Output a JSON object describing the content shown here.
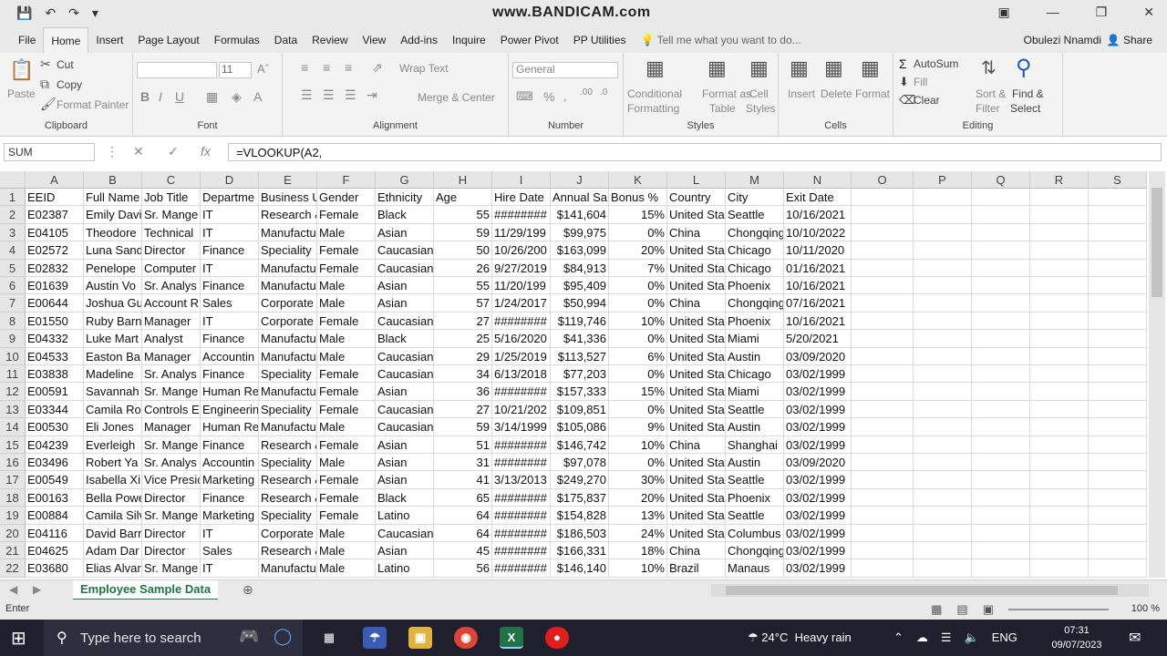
{
  "window": {
    "title": "www.BANDICAM.com",
    "user": "Obulezi Nnamdi",
    "share": "Share"
  },
  "tabs": [
    "File",
    "Home",
    "Insert",
    "Page Layout",
    "Formulas",
    "Data",
    "Review",
    "View",
    "Add-ins",
    "Inquire",
    "Power Pivot",
    "PP Utilities"
  ],
  "tell_me": "Tell me what you want to do...",
  "ribbon": {
    "clipboard": {
      "paste": "Paste",
      "cut": "Cut",
      "copy": "Copy",
      "format_painter": "Format Painter",
      "label": "Clipboard"
    },
    "font": {
      "size": "11",
      "label": "Font"
    },
    "alignment": {
      "wrap": "Wrap Text",
      "merge": "Merge & Center",
      "label": "Alignment"
    },
    "number": {
      "format": "General",
      "label": "Number"
    },
    "styles": {
      "conditional": "Conditional",
      "conditional2": "Formatting",
      "format_as": "Format as",
      "format_as2": "Table",
      "cell": "Cell",
      "cell2": "Styles",
      "label": "Styles"
    },
    "cells": {
      "insert": "Insert",
      "delete": "Delete",
      "format": "Format",
      "label": "Cells"
    },
    "editing": {
      "autosum": "AutoSum",
      "fill": "Fill",
      "clear": "Clear",
      "sort": "Sort &",
      "sort2": "Filter",
      "find": "Find &",
      "find2": "Select",
      "label": "Editing"
    }
  },
  "formula_bar": {
    "name_box": "SUM",
    "formula": "=VLOOKUP(A2,"
  },
  "columns": [
    "A",
    "B",
    "C",
    "D",
    "E",
    "F",
    "G",
    "H",
    "I",
    "J",
    "K",
    "L",
    "M",
    "N",
    "O",
    "P",
    "Q",
    "R",
    "S"
  ],
  "rows": [
    [
      "EEID",
      "Full Name",
      "Job Title",
      "Departme",
      "Business U",
      "Gender",
      "Ethnicity",
      "Age",
      "Hire Date",
      "Annual Sa",
      "Bonus %",
      "Country",
      "City",
      "Exit Date"
    ],
    [
      "E02387",
      "Emily Davi",
      "Sr. Mange",
      "IT",
      "Research &",
      "Female",
      "Black",
      "55",
      "########",
      "$141,604",
      "15%",
      "United Sta",
      "Seattle",
      "10/16/2021"
    ],
    [
      "E04105",
      "Theodore",
      "Technical",
      "IT",
      "Manufactu",
      "Male",
      "Asian",
      "59",
      "11/29/199",
      "$99,975",
      "0%",
      "China",
      "Chongqing",
      "10/10/2022"
    ],
    [
      "E02572",
      "Luna Sand",
      "Director",
      "Finance",
      "Speciality",
      "Female",
      "Caucasian",
      "50",
      "10/26/200",
      "$163,099",
      "20%",
      "United Sta",
      "Chicago",
      "10/11/2020"
    ],
    [
      "E02832",
      "Penelope",
      "Computer",
      "IT",
      "Manufactu",
      "Female",
      "Caucasian",
      "26",
      "9/27/2019",
      "$84,913",
      "7%",
      "United Sta",
      "Chicago",
      "01/16/2021"
    ],
    [
      "E01639",
      "Austin Vo",
      "Sr. Analys",
      "Finance",
      "Manufactu",
      "Male",
      "Asian",
      "55",
      "11/20/199",
      "$95,409",
      "0%",
      "United Sta",
      "Phoenix",
      "10/16/2021"
    ],
    [
      "E00644",
      "Joshua Gu",
      "Account R",
      "Sales",
      "Corporate",
      "Male",
      "Asian",
      "57",
      "1/24/2017",
      "$50,994",
      "0%",
      "China",
      "Chongqing",
      "07/16/2021"
    ],
    [
      "E01550",
      "Ruby Barn",
      "Manager",
      "IT",
      "Corporate",
      "Female",
      "Caucasian",
      "27",
      "########",
      "$119,746",
      "10%",
      "United Sta",
      "Phoenix",
      "10/16/2021"
    ],
    [
      "E04332",
      "Luke Mart",
      "Analyst",
      "Finance",
      "Manufactu",
      "Male",
      "Black",
      "25",
      "5/16/2020",
      "$41,336",
      "0%",
      "United Sta",
      "Miami",
      "5/20/2021"
    ],
    [
      "E04533",
      "Easton Ba",
      "Manager",
      "Accountin",
      "Manufactu",
      "Male",
      "Caucasian",
      "29",
      "1/25/2019",
      "$113,527",
      "6%",
      "United Sta",
      "Austin",
      "03/09/2020"
    ],
    [
      "E03838",
      "Madeline",
      "Sr. Analys",
      "Finance",
      "Speciality",
      "Female",
      "Caucasian",
      "34",
      "6/13/2018",
      "$77,203",
      "0%",
      "United Sta",
      "Chicago",
      "03/02/1999"
    ],
    [
      "E00591",
      "Savannah",
      "Sr. Mange",
      "Human Re",
      "Manufactu",
      "Female",
      "Asian",
      "36",
      "########",
      "$157,333",
      "15%",
      "United Sta",
      "Miami",
      "03/02/1999"
    ],
    [
      "E03344",
      "Camila Ro",
      "Controls E",
      "Engineerin",
      "Speciality",
      "Female",
      "Caucasian",
      "27",
      "10/21/202",
      "$109,851",
      "0%",
      "United Sta",
      "Seattle",
      "03/02/1999"
    ],
    [
      "E00530",
      "Eli Jones",
      "Manager",
      "Human Re",
      "Manufactu",
      "Male",
      "Caucasian",
      "59",
      "3/14/1999",
      "$105,086",
      "9%",
      "United Sta",
      "Austin",
      "03/02/1999"
    ],
    [
      "E04239",
      "Everleigh",
      "Sr. Mange",
      "Finance",
      "Research &",
      "Female",
      "Asian",
      "51",
      "########",
      "$146,742",
      "10%",
      "China",
      "Shanghai",
      "03/02/1999"
    ],
    [
      "E03496",
      "Robert Ya",
      "Sr. Analys",
      "Accountin",
      "Speciality",
      "Male",
      "Asian",
      "31",
      "########",
      "$97,078",
      "0%",
      "United Sta",
      "Austin",
      "03/09/2020"
    ],
    [
      "E00549",
      "Isabella Xi",
      "Vice Presic",
      "Marketing",
      "Research &",
      "Female",
      "Asian",
      "41",
      "3/13/2013",
      "$249,270",
      "30%",
      "United Sta",
      "Seattle",
      "03/02/1999"
    ],
    [
      "E00163",
      "Bella Powe",
      "Director",
      "Finance",
      "Research &",
      "Female",
      "Black",
      "65",
      "########",
      "$175,837",
      "20%",
      "United Sta",
      "Phoenix",
      "03/02/1999"
    ],
    [
      "E00884",
      "Camila Silv",
      "Sr. Mange",
      "Marketing",
      "Speciality",
      "Female",
      "Latino",
      "64",
      "########",
      "$154,828",
      "13%",
      "United Sta",
      "Seattle",
      "03/02/1999"
    ],
    [
      "E04116",
      "David Barr",
      "Director",
      "IT",
      "Corporate",
      "Male",
      "Caucasian",
      "64",
      "########",
      "$186,503",
      "24%",
      "United Sta",
      "Columbus",
      "03/02/1999"
    ],
    [
      "E04625",
      "Adam Dar",
      "Director",
      "Sales",
      "Research &",
      "Male",
      "Asian",
      "45",
      "########",
      "$166,331",
      "18%",
      "China",
      "Chongqing",
      "03/02/1999"
    ],
    [
      "E03680",
      "Elias Alvar",
      "Sr. Mange",
      "IT",
      "Manufactu",
      "Male",
      "Latino",
      "56",
      "########",
      "$146,140",
      "10%",
      "Brazil",
      "Manaus",
      "03/02/1999"
    ]
  ],
  "sheet": {
    "name": "Employee Sample Data",
    "status": "Enter",
    "zoom": "100 %"
  },
  "taskbar": {
    "search_placeholder": "Type here to search",
    "temperature": "24°C",
    "weather": "Heavy rain",
    "language": "ENG",
    "time": "07:31",
    "date": "09/07/2023"
  },
  "colors": {
    "excel_green": "#217346",
    "taskbar": "#1f1f2e"
  }
}
